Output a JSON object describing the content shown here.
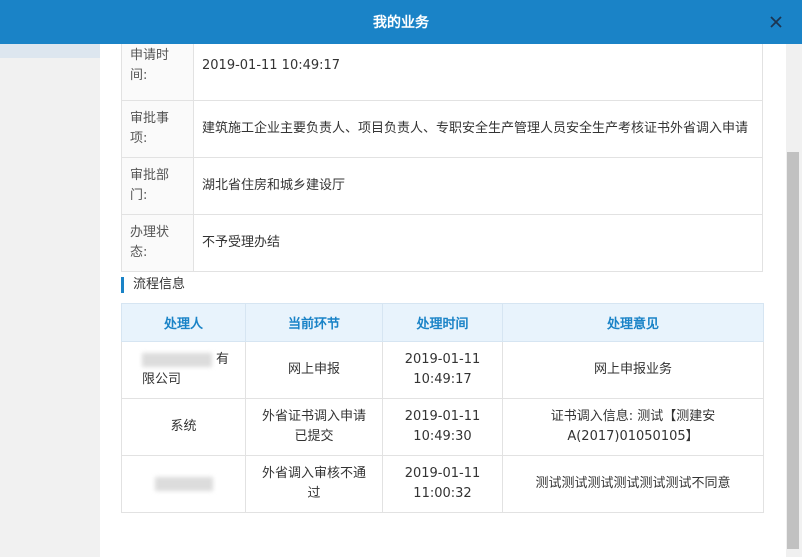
{
  "modal": {
    "title": "我的业务"
  },
  "info": [
    {
      "label": "申请时间:",
      "value": "2019-01-11 10:49:17"
    },
    {
      "label": "审批事项:",
      "value": "建筑施工企业主要负责人、项目负责人、专职安全生产管理人员安全生产考核证书外省调入申请"
    },
    {
      "label": "审批部门:",
      "value": "湖北省住房和城乡建设厅"
    },
    {
      "label": "办理状态:",
      "value": "不予受理办结"
    }
  ],
  "process": {
    "title": "流程信息",
    "headers": [
      "处理人",
      "当前环节",
      "处理时间",
      "处理意见"
    ],
    "rows": [
      {
        "handler": "有限公司",
        "step": "网上申报",
        "time": "2019-01-11 10:49:17",
        "opinion": "网上申报业务"
      },
      {
        "handler": "系统",
        "step": "外省证书调入申请已提交",
        "time": "2019-01-11 10:49:30",
        "opinion": "证书调入信息: 测试【测建安A(2017)01050105】"
      },
      {
        "handler": "",
        "step": "外省调入审核不通过",
        "time": "2019-01-11 11:00:32",
        "opinion": "测试测试测试测试测试测试不同意"
      }
    ]
  }
}
